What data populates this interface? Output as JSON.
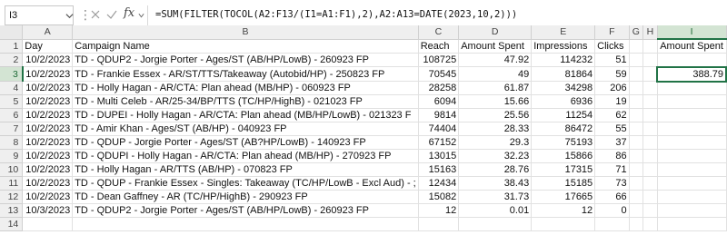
{
  "name_box": "I3",
  "formula": "=SUM(FILTER(TOCOL(A2:F13/(I1=A1:F1),2),A2:A13=DATE(2023,10,2)))",
  "fbar_separator": "⋮",
  "fx_label": "fx",
  "columns": [
    "A",
    "B",
    "C",
    "D",
    "E",
    "F",
    "G",
    "H",
    "I"
  ],
  "row_numbers": [
    "1",
    "2",
    "3",
    "4",
    "5",
    "6",
    "7",
    "8",
    "9",
    "10",
    "11",
    "12",
    "13",
    "14"
  ],
  "headers": {
    "day": "Day",
    "campaign": "Campaign Name",
    "reach": "Reach",
    "amount_spent": "Amount Spent",
    "impressions": "Impressions",
    "clicks": "Clicks",
    "i_header": "Amount Spent"
  },
  "rows": [
    [
      "10/2/2023",
      "TD - QDUP2 - Jorgie Porter - Ages/ST (AB/HP/LowB) - 260923 FP",
      "108725",
      "47.92",
      "114232",
      "51"
    ],
    [
      "10/2/2023",
      "TD - Frankie Essex - AR/ST/TTS/Takeaway (Autobid/HP) - 250823 FP",
      "70545",
      "49",
      "81864",
      "59"
    ],
    [
      "10/2/2023",
      "TD - Holly Hagan - AR/CTA: Plan ahead (MB/HP) - 060923 FP",
      "28258",
      "61.87",
      "34298",
      "206"
    ],
    [
      "10/2/2023",
      "TD - Multi Celeb - AR/25-34/BP/TTS (TC/HP/HighB) - 021023 FP",
      "6094",
      "15.66",
      "6936",
      "19"
    ],
    [
      "10/2/2023",
      "TD - DUPEI - Holly Hagan - AR/CTA: Plan ahead (MB/HP/LowB) - 021323 F",
      "9814",
      "25.56",
      "11254",
      "62"
    ],
    [
      "10/2/2023",
      "TD - Amir Khan - Ages/ST (AB/HP) - 040923 FP",
      "74404",
      "28.33",
      "86472",
      "55"
    ],
    [
      "10/2/2023",
      "TD - QDUP - Jorgie Porter - Ages/ST (AB?HP/LowB) - 140923 FP",
      "67152",
      "29.3",
      "75193",
      "37"
    ],
    [
      "10/2/2023",
      "TD - QDUPI - Holly Hagan - AR/CTA: Plan ahead (MB/HP) - 270923 FP",
      "13015",
      "32.23",
      "15866",
      "86"
    ],
    [
      "10/2/2023",
      "TD - Holly Hagan - AR/TTS (AB/HP) - 070823 FP",
      "15163",
      "28.76",
      "17315",
      "71"
    ],
    [
      "10/2/2023",
      "TD - QDUP - Frankie Essex - Singles: Takeaway (TC/HP/LowB - Excl Aud) - ;",
      "12434",
      "38.43",
      "15185",
      "73"
    ],
    [
      "10/2/2023",
      "TD - Dean Gaffney - AR (TC/HP/HighB) - 290923 FP",
      "15082",
      "31.73",
      "17665",
      "66"
    ],
    [
      "10/3/2023",
      "TD - QDUP2 - Jorgie Porter - Ages/ST (AB/HP/LowB) - 260923 FP",
      "12",
      "0.01",
      "12",
      "0"
    ]
  ],
  "result_value": "388.79",
  "colors": {
    "accent": "#217346",
    "header_bg": "#efefef",
    "gridline": "#e1e1e1"
  }
}
